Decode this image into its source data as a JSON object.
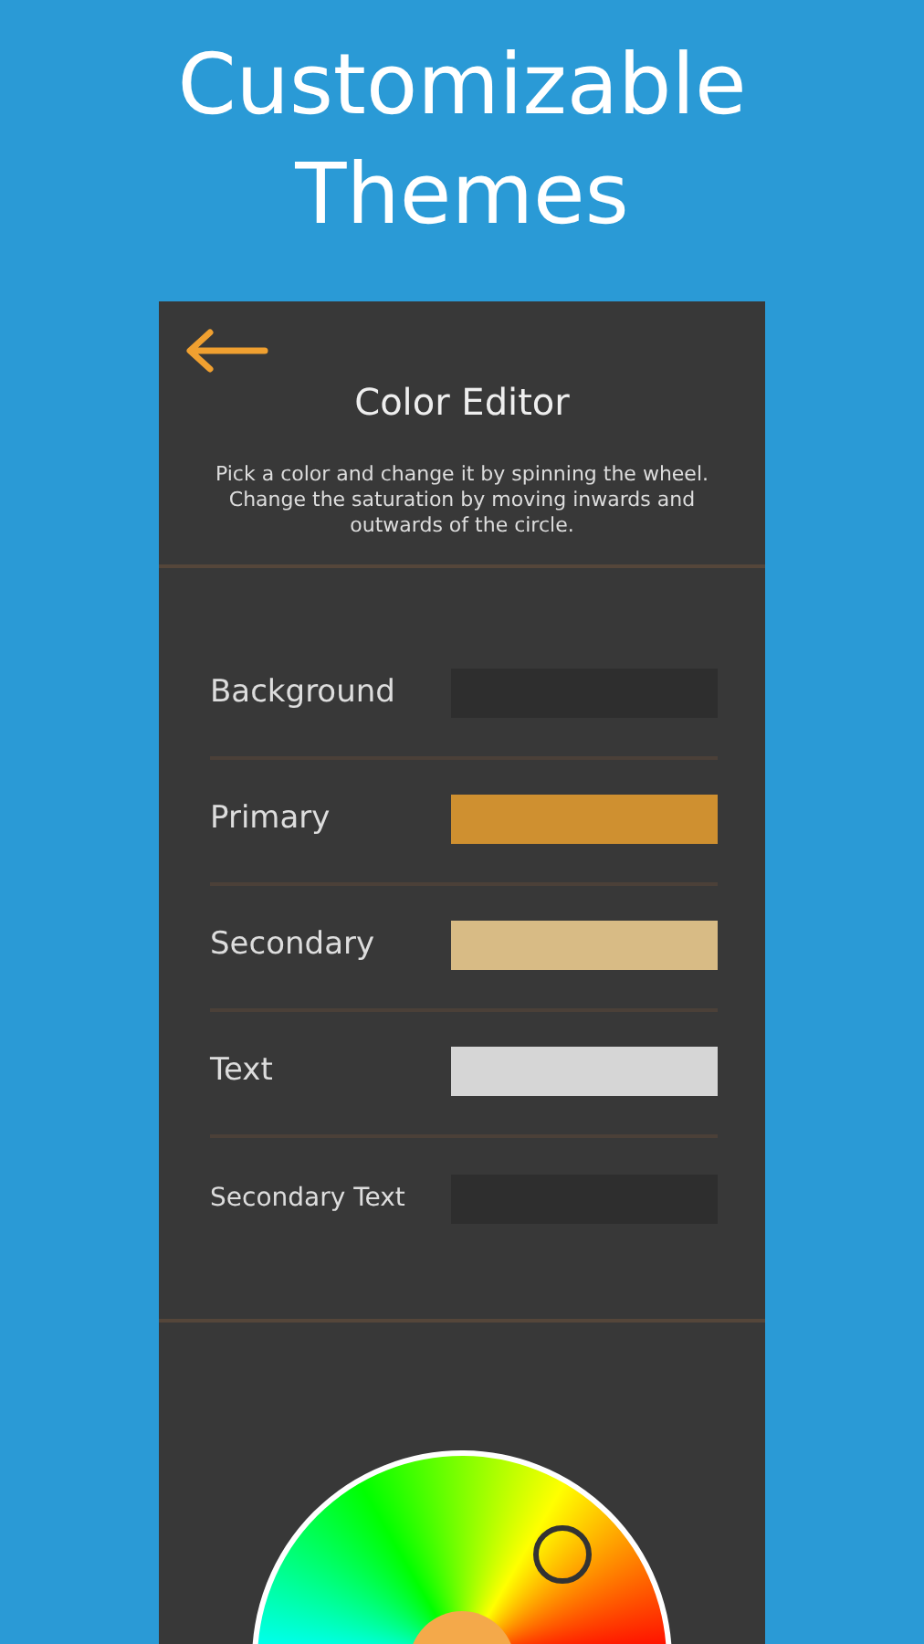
{
  "headline": "Customizable Themes",
  "screen": {
    "title": "Color Editor",
    "description": "Pick a color and change it by spinning the wheel. Change the saturation by moving inwards and outwards of the circle.",
    "colors": [
      {
        "label": "Background",
        "color": "#2e2e2e"
      },
      {
        "label": "Primary",
        "color": "#cf9030"
      },
      {
        "label": "Secondary",
        "color": "#d8bb85"
      },
      {
        "label": "Text",
        "color": "#d6d6d6"
      },
      {
        "label": "Secondary Text",
        "color": "#2e2e2e"
      }
    ],
    "wheel": {
      "kind": "color-wheel"
    }
  }
}
